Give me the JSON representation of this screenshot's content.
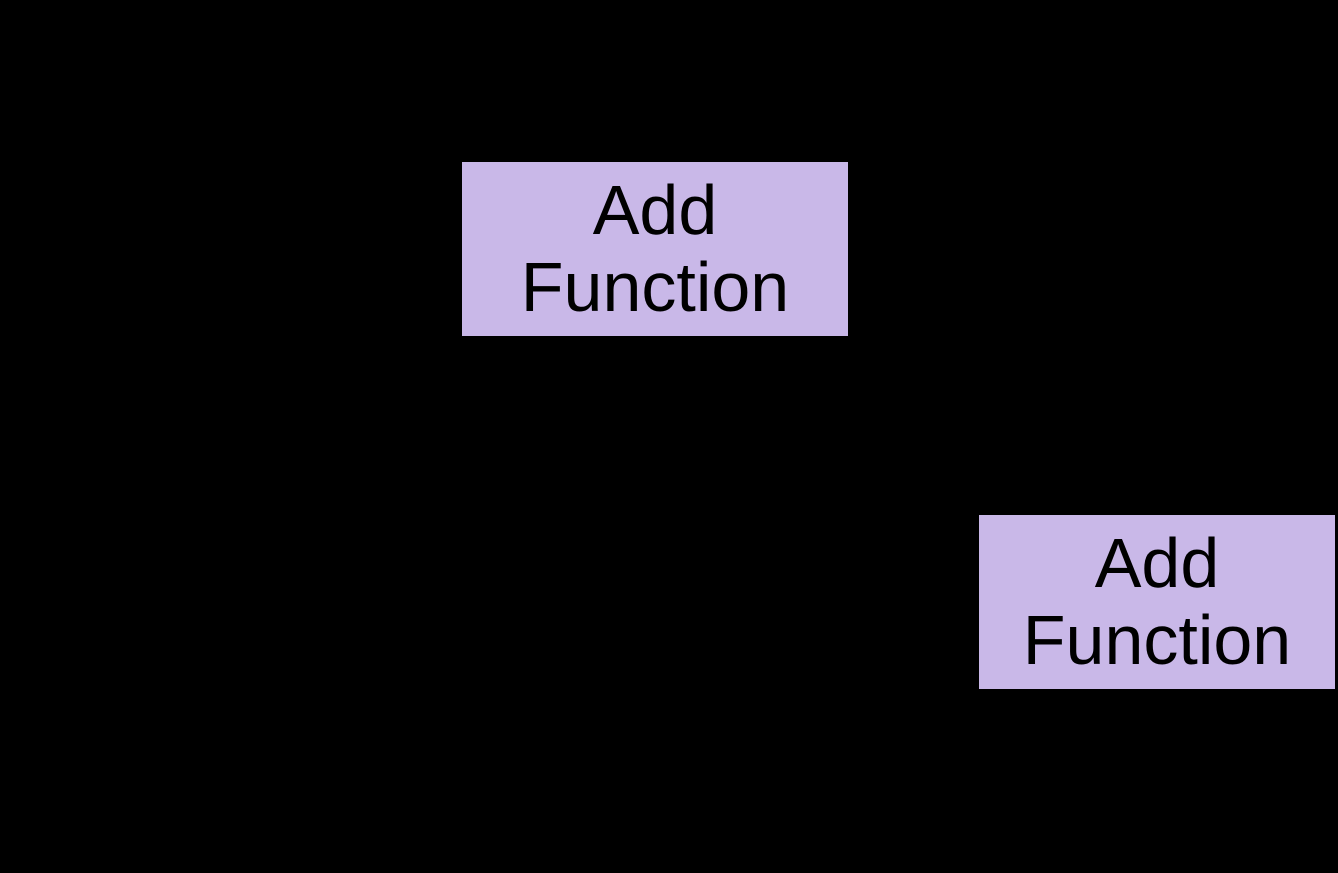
{
  "nodes": {
    "first": {
      "line1": "Add",
      "line2": "Function"
    },
    "second": {
      "line1": "Add",
      "line2": "Function"
    }
  },
  "colors": {
    "background": "#000000",
    "nodeFill": "#c9b8e8",
    "nodeText": "#000000"
  }
}
